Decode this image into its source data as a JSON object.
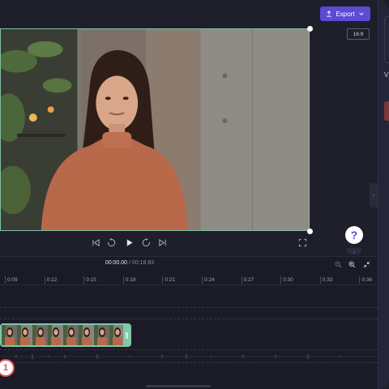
{
  "toolbar": {
    "export_label": "Export",
    "aspect_ratio": "16:9"
  },
  "right_panel": {
    "partial_letter": "V"
  },
  "playback": {
    "current_time": "00:00.00",
    "separator": " / ",
    "total_time": "00:18.83"
  },
  "help": {
    "label": "?"
  },
  "timeline": {
    "ticks": [
      "0:09",
      "0:12",
      "0:15",
      "0:18",
      "0:21",
      "0:24",
      "0:27",
      "0:30",
      "0:33",
      "0:36"
    ]
  },
  "onboarding": {
    "step_badge": "1"
  },
  "colors": {
    "accent": "#5b4bd5",
    "selection": "#7fc8a8",
    "background": "#1f1f2c"
  }
}
